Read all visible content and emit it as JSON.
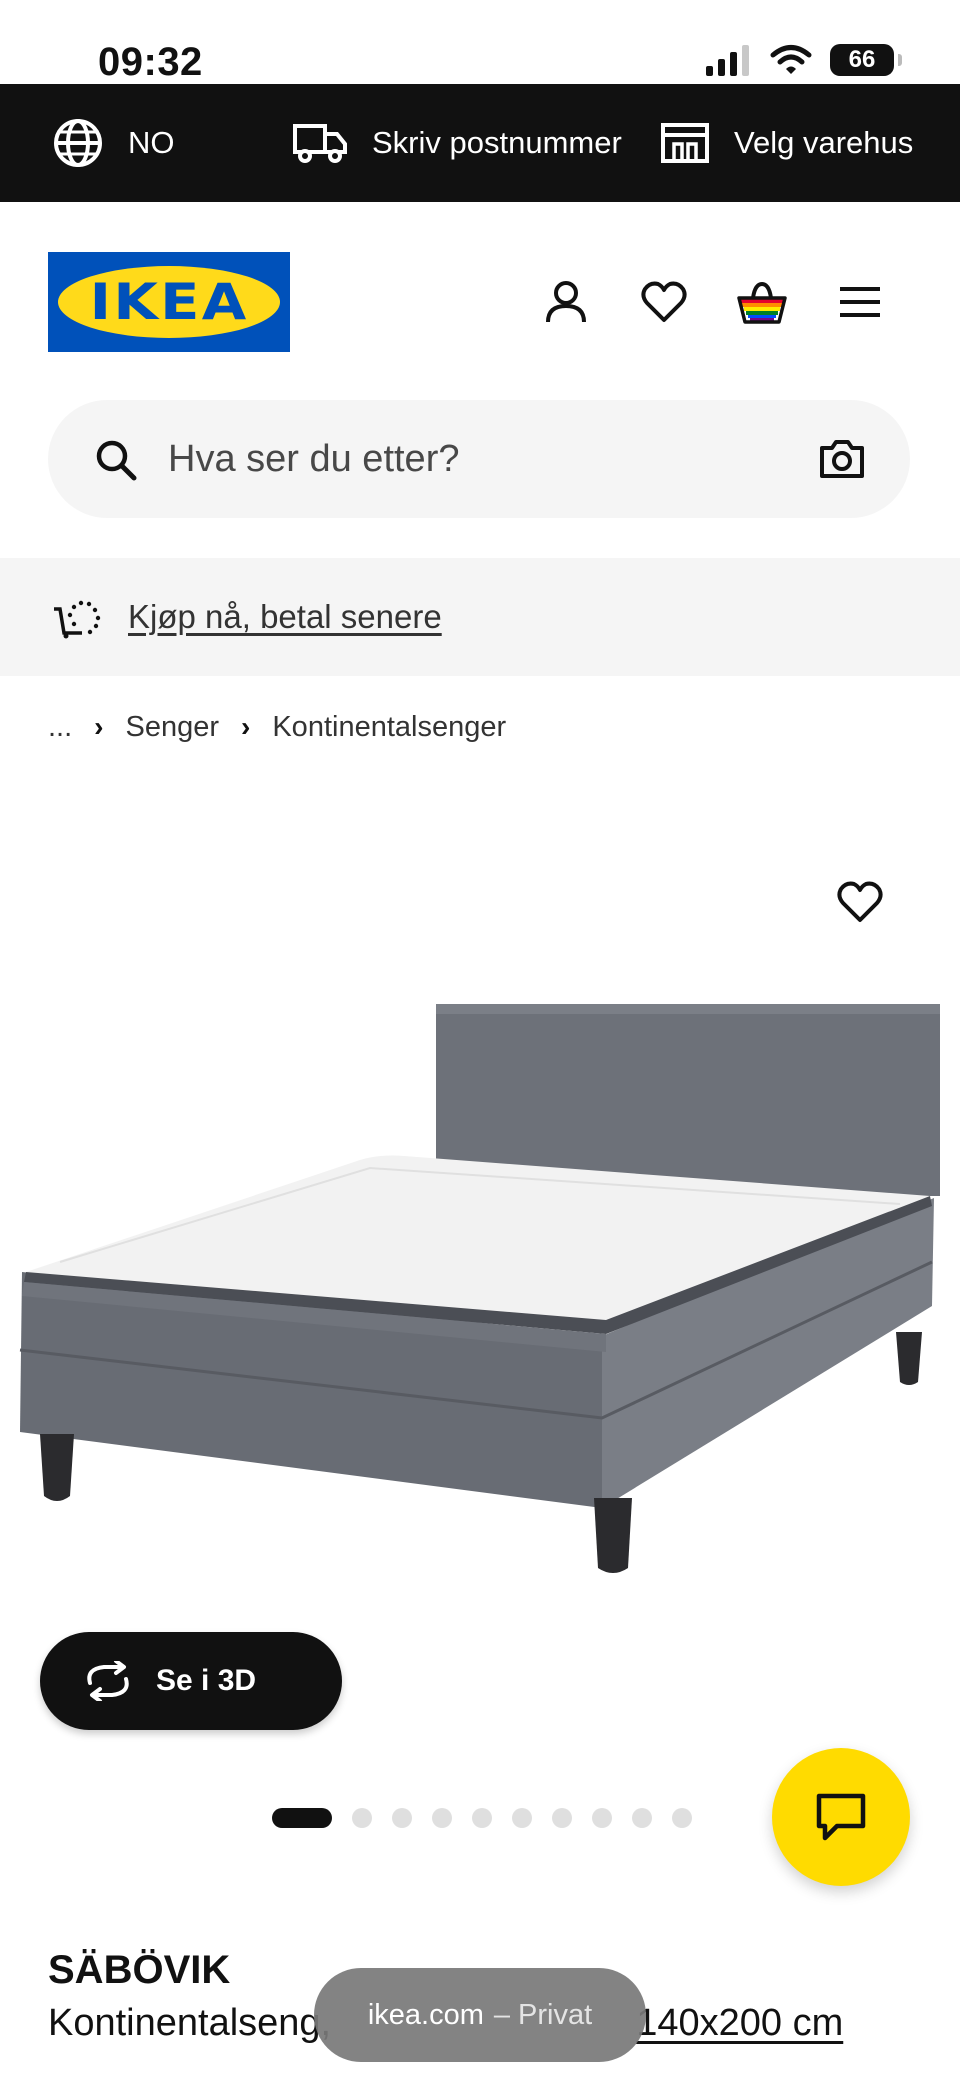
{
  "status_bar": {
    "time": "09:32",
    "battery": "66"
  },
  "top_bar": {
    "country": "NO",
    "postal": "Skriv postnummer",
    "store": "Velg varehus"
  },
  "header": {
    "logo_text": "IKEA"
  },
  "search": {
    "placeholder": "Hva ser du etter?"
  },
  "promo": {
    "link": "Kjøp nå, betal senere"
  },
  "breadcrumb": {
    "ellipsis": "...",
    "items": [
      "Senger",
      "Kontinentalsenger"
    ]
  },
  "pill_3d": {
    "label": "Se i 3D"
  },
  "carousel": {
    "total": 10,
    "active": 1
  },
  "product": {
    "name": "SÄBÖVIK",
    "description": "Kontinentalseng,",
    "size": "140x200 cm"
  },
  "browser": {
    "domain": "ikea.com",
    "mode": "– Privat"
  },
  "colors": {
    "ikea_blue": "#0051ba",
    "ikea_yellow": "#ffda1a",
    "chat_yellow": "#ffdb00",
    "top_bar": "#111111"
  },
  "icons": [
    "globe-icon",
    "truck-icon",
    "store-icon",
    "profile-icon",
    "heart-icon",
    "basket-icon",
    "menu-icon",
    "search-icon",
    "camera-icon",
    "cart-clock-icon",
    "rotate-3d-icon",
    "chat-icon"
  ]
}
